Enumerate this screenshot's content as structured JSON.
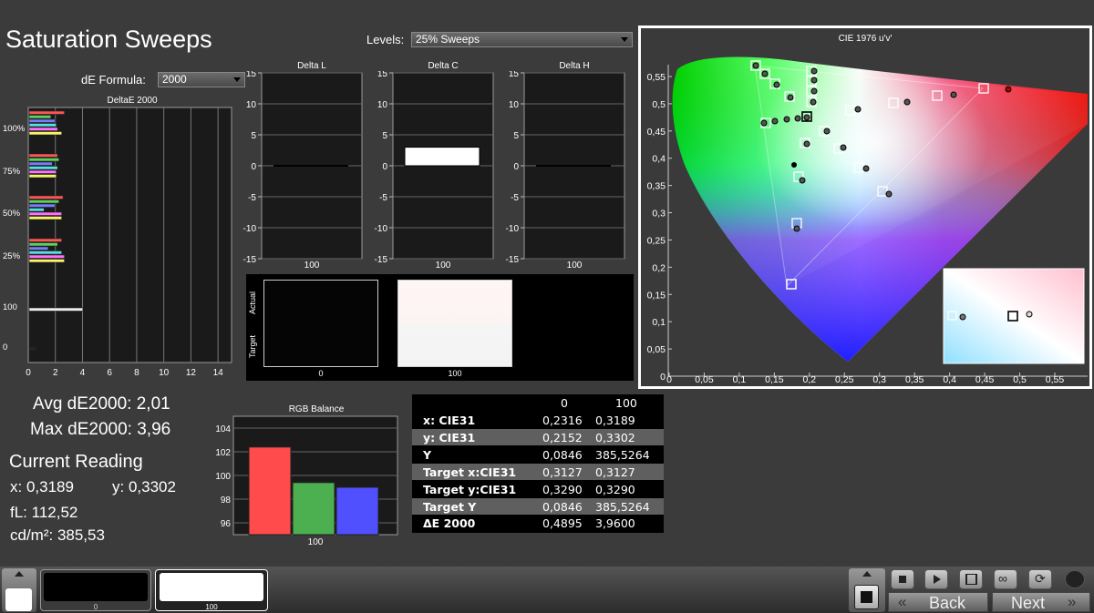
{
  "page_title": "Saturation Sweeps",
  "levels": {
    "label": "Levels:",
    "value": "25% Sweeps"
  },
  "formula": {
    "label": "dE Formula:",
    "value": "2000"
  },
  "deltae_chart": {
    "title": "DeltaE 2000",
    "y_labels": [
      "100%",
      "75%",
      "50%",
      "25%",
      "100",
      "0"
    ],
    "x_ticks": [
      "0",
      "2",
      "4",
      "6",
      "8",
      "10",
      "12",
      "14"
    ],
    "groups": [
      {
        "label": "100%",
        "values": [
          2.6,
          1.6,
          1.9,
          2.0,
          2.1,
          2.4
        ]
      },
      {
        "label": "75%",
        "values": [
          2.1,
          2.2,
          1.7,
          2.1,
          2.0,
          2.0
        ]
      },
      {
        "label": "50%",
        "values": [
          2.5,
          2.2,
          1.9,
          1.1,
          2.4,
          2.4
        ]
      },
      {
        "label": "25%",
        "values": [
          2.4,
          2.1,
          1.4,
          2.4,
          2.6,
          2.6
        ]
      },
      {
        "label": "100",
        "values": [
          3.96
        ]
      },
      {
        "label": "0",
        "values": [
          0.49
        ]
      }
    ],
    "colors": [
      "#ff5555",
      "#5bd35b",
      "#7b7bff",
      "#55e0e0",
      "#ff70ff",
      "#f5f566"
    ]
  },
  "delta_charts": [
    {
      "title": "Delta L",
      "y_ticks": [
        "15",
        "10",
        "5",
        "0",
        "-5",
        "-10",
        "-15"
      ],
      "x_label": "100",
      "value": 0
    },
    {
      "title": "Delta C",
      "y_ticks": [
        "15",
        "10",
        "5",
        "0",
        "-5",
        "-10",
        "-15"
      ],
      "x_label": "100",
      "value": 3.0
    },
    {
      "title": "Delta H",
      "y_ticks": [
        "15",
        "10",
        "5",
        "0",
        "-5",
        "-10",
        "-15"
      ],
      "x_label": "100",
      "value": 0
    }
  ],
  "swatch_panel": {
    "actual_label": "Actual",
    "target_label": "Target",
    "labels": [
      "0",
      "100"
    ]
  },
  "cie": {
    "title": "CIE 1976 u'v'",
    "y_ticks": [
      "0,55",
      "0,5",
      "0,45",
      "0,4",
      "0,35",
      "0,3",
      "0,25",
      "0,2",
      "0,15",
      "0,1",
      "0,05",
      "0"
    ],
    "x_ticks": [
      "0",
      "0,05",
      "0,1",
      "0,15",
      "0,2",
      "0,25",
      "0,3",
      "0,35",
      "0,4",
      "0,45",
      "0,5",
      "0,55"
    ]
  },
  "metrics": {
    "avg": "Avg dE2000: 2,01",
    "max": "Max dE2000: 3,96"
  },
  "current_reading": {
    "title": "Current Reading",
    "x": "x: 0,3189",
    "y": "y: 0,3302",
    "fl": "fL: 112,52",
    "cdm2": "cd/m²: 385,53"
  },
  "rgb_balance": {
    "title": "RGB Balance",
    "y_ticks": [
      "104",
      "102",
      "100",
      "98",
      "96"
    ],
    "x_label": "100",
    "ylim": [
      95,
      105
    ],
    "values": [
      {
        "name": "R",
        "value": 102.4,
        "color": "#ff4b4b"
      },
      {
        "name": "G",
        "value": 99.4,
        "color": "#4caf50"
      },
      {
        "name": "B",
        "value": 99.0,
        "color": "#5050ff"
      }
    ]
  },
  "table": {
    "headers": [
      "",
      "0",
      "100"
    ],
    "rows": [
      {
        "label": "x: CIE31",
        "v0": "0,2316",
        "v100": "0,3189"
      },
      {
        "label": "y: CIE31",
        "v0": "0,2152",
        "v100": "0,3302"
      },
      {
        "label": "Y",
        "v0": "0,0846",
        "v100": "385,5264"
      },
      {
        "label": "Target x:CIE31",
        "v0": "0,3127",
        "v100": "0,3127"
      },
      {
        "label": "Target y:CIE31",
        "v0": "0,3290",
        "v100": "0,3290"
      },
      {
        "label": "Target Y",
        "v0": "0,0846",
        "v100": "385,5264"
      },
      {
        "label": "ΔE 2000",
        "v0": "0,4895",
        "v100": "3,9600"
      }
    ]
  },
  "bottom": {
    "swatches": [
      {
        "label": "0",
        "color": "#000000"
      },
      {
        "label": "100",
        "color": "#ffffff"
      }
    ],
    "back_label": "Back",
    "next_label": "Next",
    "controls": [
      "stop-icon",
      "play-icon",
      "hold-icon",
      "loop-icon",
      "refresh-icon"
    ]
  }
}
